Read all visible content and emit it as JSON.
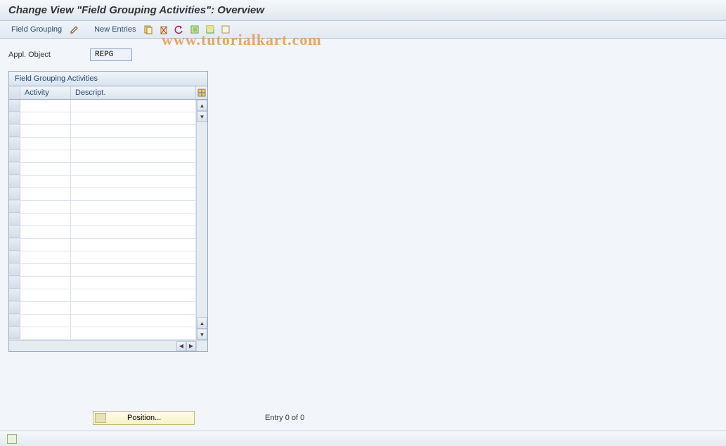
{
  "header": {
    "title": "Change View \"Field Grouping Activities\": Overview"
  },
  "toolbar": {
    "field_grouping_label": "Field Grouping",
    "new_entries_label": "New Entries"
  },
  "appl_object": {
    "label": "Appl. Object",
    "value": "REPG"
  },
  "table": {
    "title": "Field Grouping Activities",
    "columns": {
      "activity": "Activity",
      "descript": "Descript."
    },
    "row_count": 19
  },
  "footer": {
    "position_label": "Position...",
    "entry_text": "Entry 0 of 0"
  },
  "watermark": "www.tutorialkart.com"
}
